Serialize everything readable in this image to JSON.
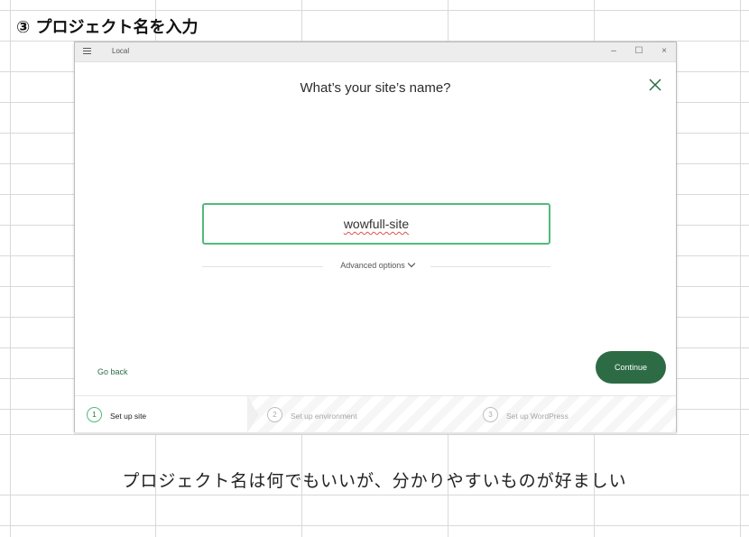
{
  "sheet": {
    "heading": "③ プロジェクト名を入力",
    "caption": "プロジェクト名は何でもいいが、分かりやすいものが好ましい"
  },
  "window": {
    "app_title": "Local",
    "controls": {
      "minimize": "–",
      "maximize": "☐",
      "close": "×"
    }
  },
  "dialog": {
    "title": "What’s your site’s name?",
    "site_name_value": "wowfull-site",
    "advanced_options_label": "Advanced options",
    "go_back_label": "Go back",
    "continue_label": "Continue",
    "steps": [
      {
        "number": "1",
        "label": "Set up site",
        "state": "active"
      },
      {
        "number": "2",
        "label": "Set up environment",
        "state": "inactive"
      },
      {
        "number": "3",
        "label": "Set up WordPress",
        "state": "inactive"
      }
    ]
  },
  "colors": {
    "accent_green": "#2d6b45",
    "input_border": "#51bb7b",
    "active_step_circle": "#51bb7b"
  }
}
